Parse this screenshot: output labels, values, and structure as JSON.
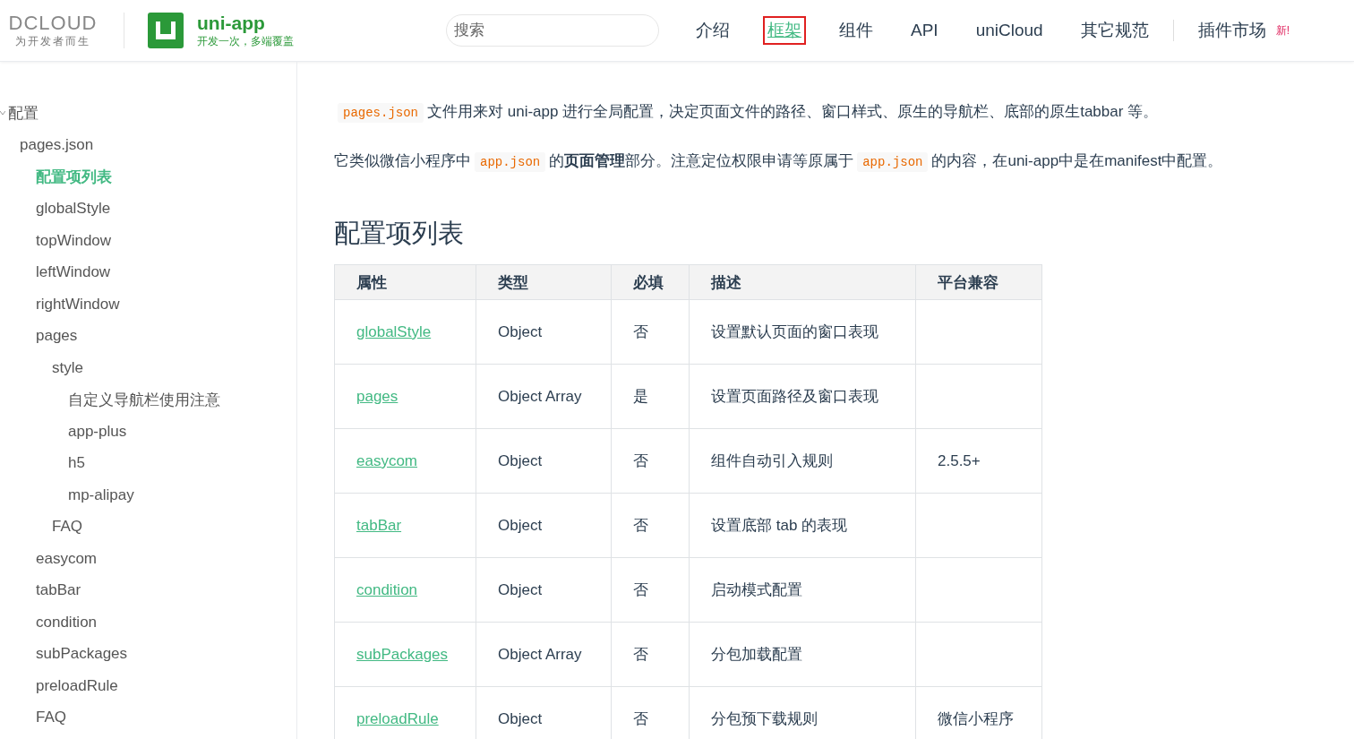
{
  "header": {
    "brand": {
      "logo": "DCLOUD",
      "tagline": "为开发者而生"
    },
    "product": {
      "name": "uni-app",
      "tagline": "开发一次，多端覆盖"
    },
    "search": {
      "placeholder": "搜索"
    },
    "nav": [
      {
        "label": "介绍",
        "selected": false
      },
      {
        "label": "框架",
        "selected": true
      },
      {
        "label": "组件",
        "selected": false
      },
      {
        "label": "API",
        "selected": false
      },
      {
        "label": "uniCloud",
        "selected": false
      },
      {
        "label": "其它规范",
        "selected": false
      },
      {
        "label": "插件市场",
        "selected": false,
        "badge": "新!"
      }
    ]
  },
  "sidebar": {
    "items": [
      {
        "label": "配置",
        "selected": false,
        "expanded": true,
        "children": [
          {
            "label": "pages.json",
            "selected": false,
            "children": [
              {
                "label": "配置项列表",
                "selected": true
              },
              {
                "label": "globalStyle",
                "selected": false
              },
              {
                "label": "topWindow",
                "selected": false
              },
              {
                "label": "leftWindow",
                "selected": false
              },
              {
                "label": "rightWindow",
                "selected": false
              },
              {
                "label": "pages",
                "selected": false,
                "children": [
                  {
                    "label": "style",
                    "selected": false,
                    "children": [
                      {
                        "label": "自定义导航栏使用注意",
                        "selected": false
                      },
                      {
                        "label": "app-plus",
                        "selected": false
                      },
                      {
                        "label": "h5",
                        "selected": false
                      },
                      {
                        "label": "mp-alipay",
                        "selected": false
                      }
                    ]
                  },
                  {
                    "label": "FAQ",
                    "selected": false
                  }
                ]
              },
              {
                "label": "easycom",
                "selected": false
              },
              {
                "label": "tabBar",
                "selected": false
              },
              {
                "label": "condition",
                "selected": false
              },
              {
                "label": "subPackages",
                "selected": false
              },
              {
                "label": "preloadRule",
                "selected": false
              },
              {
                "label": "FAQ",
                "selected": false
              }
            ]
          }
        ]
      }
    ]
  },
  "content": {
    "paragraphs": [
      [
        {
          "kind": "code",
          "text": "pages.json"
        },
        {
          "kind": "text",
          "text": "文件用来对 uni-app 进行全局配置，决定页面文件的路径、窗口样式、原生的导航栏、底部的原生tabbar 等。"
        }
      ],
      [
        {
          "kind": "text",
          "text": "它类似微信小程序中"
        },
        {
          "kind": "code",
          "text": "app.json"
        },
        {
          "kind": "text",
          "text": "的**页面管理**部分。注意定位权限申请等原属于"
        },
        {
          "kind": "code",
          "text": "app.json"
        },
        {
          "kind": "text",
          "text": "的内容，在uni-app中是在manifest中配置。"
        }
      ]
    ],
    "heading": "配置项列表",
    "table": {
      "columns": [
        "属性",
        "类型",
        "必填",
        "描述",
        "平台兼容"
      ],
      "rows": [
        [
          "globalStyle",
          "Object",
          "否",
          "设置默认页面的窗口表现",
          ""
        ],
        [
          "pages",
          "Object Array",
          "是",
          "设置页面路径及窗口表现",
          ""
        ],
        [
          "easycom",
          "Object",
          "否",
          "组件自动引入规则",
          "2.5.5+"
        ],
        [
          "tabBar",
          "Object",
          "否",
          "设置底部 tab 的表现",
          ""
        ],
        [
          "condition",
          "Object",
          "否",
          "启动模式配置",
          ""
        ],
        [
          "subPackages",
          "Object Array",
          "否",
          "分包加载配置",
          ""
        ],
        [
          "preloadRule",
          "Object",
          "否",
          "分包预下载规则",
          "微信小程序"
        ]
      ]
    }
  }
}
